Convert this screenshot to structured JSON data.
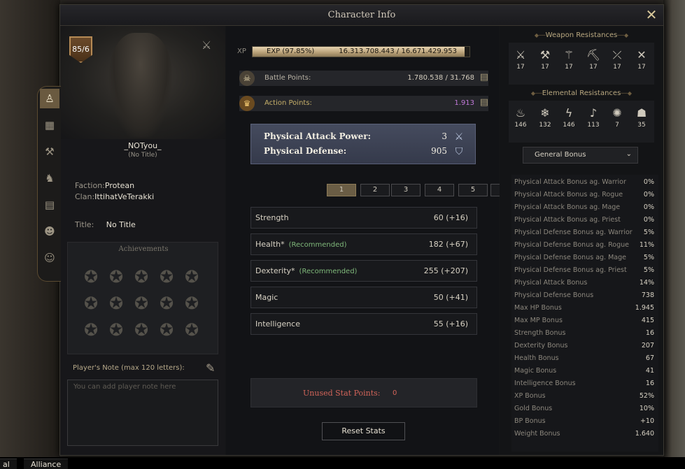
{
  "window": {
    "title": "Character Info"
  },
  "character": {
    "level": "85/6",
    "name": "_NOTyou_",
    "title_sub": "(No Title)",
    "faction_label": "Faction:",
    "faction": "Protean",
    "clan_label": "Clan:",
    "clan": "IttihatVeTerakki",
    "title_label": "Title:",
    "title": "No Title"
  },
  "achievements": {
    "heading": "Achievements"
  },
  "note": {
    "label": "Player's Note (max 120 letters):",
    "placeholder": "You can add player note here"
  },
  "xp": {
    "label": "XP",
    "percent_text": "EXP (97.85%)",
    "progress": 0.9785,
    "value_text": "16.313.708.443 / 16.671.429.953"
  },
  "battle_points": {
    "label": "Battle Points:",
    "value": "1.780.538 / 31.768"
  },
  "action_points": {
    "label": "Action Points:",
    "value": "1.913"
  },
  "combat": {
    "attack_label": "Physical Attack Power:",
    "attack_value": "3",
    "defense_label": "Physical Defense:",
    "defense_value": "905"
  },
  "pages": [
    "1",
    "2",
    "3",
    "4",
    "5"
  ],
  "attributes": [
    {
      "name": "Strength",
      "recommended": "",
      "value": "60 (+16)"
    },
    {
      "name": "Health*",
      "recommended": "(Recommended)",
      "value": "182 (+67)"
    },
    {
      "name": "Dexterity*",
      "recommended": "(Recommended)",
      "value": "255 (+207)"
    },
    {
      "name": "Magic",
      "recommended": "",
      "value": "50 (+41)"
    },
    {
      "name": "Intelligence",
      "recommended": "",
      "value": "55 (+16)"
    }
  ],
  "unused": {
    "label": "Unused Stat Points:",
    "value": "0"
  },
  "reset_label": "Reset Stats",
  "weapon_resistances": {
    "heading": "Weapon Resistances",
    "items": [
      {
        "icon": "crossed-swords-icon",
        "value": "17"
      },
      {
        "icon": "crossed-axes-icon",
        "value": "17"
      },
      {
        "icon": "mace-icon",
        "value": "17"
      },
      {
        "icon": "crossed-picks-icon",
        "value": "17"
      },
      {
        "icon": "crossed-spears-icon",
        "value": "17"
      },
      {
        "icon": "crossed-daggers-icon",
        "value": "17"
      }
    ]
  },
  "elemental_resistances": {
    "heading": "Elemental Resistances",
    "items": [
      {
        "icon": "fire-icon",
        "value": "146"
      },
      {
        "icon": "ice-icon",
        "value": "132"
      },
      {
        "icon": "lightning-icon",
        "value": "146"
      },
      {
        "icon": "poison-icon",
        "value": "113"
      },
      {
        "icon": "holy-icon",
        "value": "7"
      },
      {
        "icon": "curse-icon",
        "value": "35"
      }
    ]
  },
  "bonus_dropdown": "General Bonus",
  "bonuses": [
    {
      "name": "Physical Attack Bonus ag. Warrior",
      "value": "0%"
    },
    {
      "name": "Physical Attack Bonus ag. Rogue",
      "value": "0%"
    },
    {
      "name": "Physical Attack Bonus ag. Mage",
      "value": "0%"
    },
    {
      "name": "Physical Attack Bonus ag. Priest",
      "value": "0%"
    },
    {
      "name": "Physical Defense Bonus ag. Warrior",
      "value": "5%"
    },
    {
      "name": "Physical Defense Bonus ag. Rogue",
      "value": "11%"
    },
    {
      "name": "Physical Defense Bonus ag. Mage",
      "value": "5%"
    },
    {
      "name": "Physical Defense Bonus ag. Priest",
      "value": "5%"
    },
    {
      "name": "Physical Attack Bonus",
      "value": "14%"
    },
    {
      "name": "Physical Defense Bonus",
      "value": "738"
    },
    {
      "name": "Max HP Bonus",
      "value": "1.945"
    },
    {
      "name": "Max MP Bonus",
      "value": "415"
    },
    {
      "name": "Strength Bonus",
      "value": "16"
    },
    {
      "name": "Dexterity Bonus",
      "value": "207"
    },
    {
      "name": "Health Bonus",
      "value": "67"
    },
    {
      "name": "Magic Bonus",
      "value": "41"
    },
    {
      "name": "Intelligence Bonus",
      "value": "16"
    },
    {
      "name": "XP Bonus",
      "value": "52%"
    },
    {
      "name": "Gold Bonus",
      "value": "10%"
    },
    {
      "name": "BP Bonus",
      "value": "+10"
    },
    {
      "name": "Weight Bonus",
      "value": "1.640"
    }
  ],
  "bottom_tabs": [
    "al",
    "Alliance"
  ]
}
